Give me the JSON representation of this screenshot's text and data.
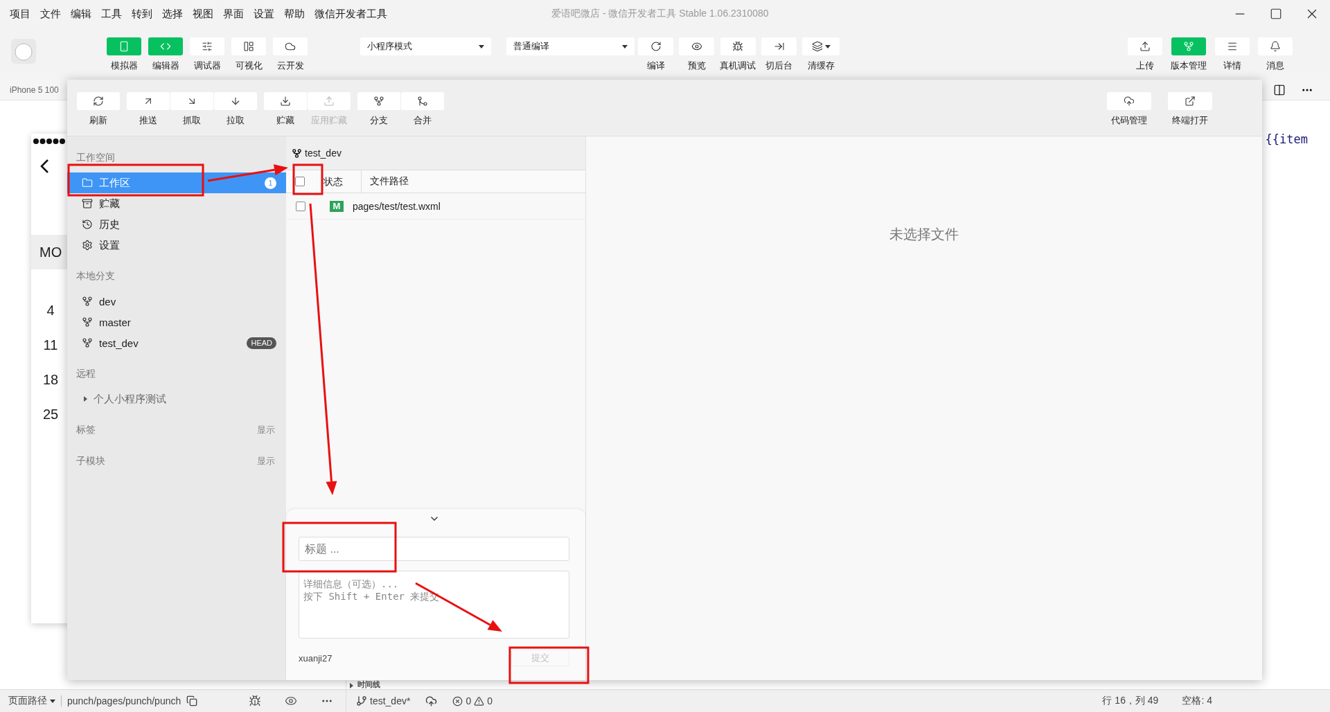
{
  "menu": [
    "项目",
    "文件",
    "编辑",
    "工具",
    "转到",
    "选择",
    "视图",
    "界面",
    "设置",
    "帮助",
    "微信开发者工具"
  ],
  "window": {
    "title": "爱语吧微店 - 微信开发者工具 Stable 1.06.2310080"
  },
  "toolbar": {
    "left": [
      {
        "label": "模拟器",
        "kind": "simulator",
        "selected": true
      },
      {
        "label": "编辑器",
        "kind": "editor",
        "selected": true
      },
      {
        "label": "调试器",
        "kind": "debugger",
        "selected": false
      },
      {
        "label": "可视化",
        "kind": "visual",
        "selected": false
      },
      {
        "label": "云开发",
        "kind": "cloud",
        "selected": false
      }
    ],
    "mode_select": "小程序模式",
    "compile_select": "普通编译",
    "center": [
      {
        "label": "编译",
        "kind": "compile"
      },
      {
        "label": "预览",
        "kind": "preview"
      },
      {
        "label": "真机调试",
        "kind": "remote-debug"
      },
      {
        "label": "切后台",
        "kind": "background"
      },
      {
        "label": "清缓存",
        "kind": "cache"
      }
    ],
    "right": [
      {
        "label": "上传",
        "kind": "upload",
        "selected": false
      },
      {
        "label": "版本管理",
        "kind": "version",
        "selected": true
      },
      {
        "label": "详情",
        "kind": "details",
        "selected": false
      },
      {
        "label": "消息",
        "kind": "messages",
        "selected": false
      }
    ]
  },
  "simulator": {
    "device": "iPhone 5 100",
    "calendar_header": "MO",
    "days": [
      "4",
      "11",
      "18",
      "25"
    ]
  },
  "git": {
    "toolbar_groups": [
      [
        {
          "label": "刷新",
          "kind": "refresh",
          "disabled": false
        }
      ],
      [
        {
          "label": "推送",
          "kind": "push",
          "disabled": false
        },
        {
          "label": "抓取",
          "kind": "fetch",
          "disabled": false
        },
        {
          "label": "拉取",
          "kind": "pull",
          "disabled": false
        }
      ],
      [
        {
          "label": "贮藏",
          "kind": "stash",
          "disabled": false
        },
        {
          "label": "应用贮藏",
          "kind": "apply",
          "disabled": true
        }
      ],
      [
        {
          "label": "分支",
          "kind": "branch",
          "disabled": false
        },
        {
          "label": "合并",
          "kind": "merge",
          "disabled": false
        }
      ]
    ],
    "toolbar_right": [
      {
        "label": "代码管理",
        "kind": "code",
        "disabled": false
      },
      {
        "label": "终端打开",
        "kind": "terminal",
        "disabled": false
      }
    ],
    "sidebar": [
      {
        "title": "工作空间",
        "items": [
          {
            "label": "工作区",
            "kind": "folder",
            "selected": true,
            "badge": {
              "text": "1",
              "kind": "count"
            }
          },
          {
            "label": "贮藏",
            "kind": "stash",
            "selected": false
          },
          {
            "label": "历史",
            "kind": "history",
            "selected": false
          },
          {
            "label": "设置",
            "kind": "settings",
            "selected": false
          }
        ]
      },
      {
        "title": "本地分支",
        "items": [
          {
            "label": "dev",
            "kind": "branch",
            "selected": false
          },
          {
            "label": "master",
            "kind": "branch",
            "selected": false
          },
          {
            "label": "test_dev",
            "kind": "branch",
            "selected": false,
            "badge": {
              "text": "HEAD",
              "kind": "tag"
            }
          }
        ]
      },
      {
        "title": "远程",
        "items": [
          {
            "label": "个人小程序测试",
            "kind": "remote",
            "selected": false,
            "expanded": false
          }
        ]
      },
      {
        "title": "标签",
        "action": "显示"
      },
      {
        "title": "子模块",
        "action": "显示"
      }
    ],
    "branch": "test_dev",
    "all_checked": false,
    "columns": [
      "状态",
      "文件路径"
    ],
    "files": [
      {
        "status": "M",
        "path": "pages/test/test.wxml",
        "checked": false
      }
    ],
    "commit": {
      "title": {
        "placeholder": "标题 ..."
      },
      "detail": {
        "placeholder": "详细信息（可选）...\n按下 Shift + Enter 来提交"
      },
      "author": "xuanji27",
      "submit": {
        "label": "提交",
        "disabled": true
      }
    },
    "preview": {
      "empty_text": "未选择文件"
    }
  },
  "editor": {
    "code": "{{item",
    "timeline": "时间线"
  },
  "status_bar": {
    "path_label": "页面路径",
    "path": "punch/pages/punch/punch",
    "branch": "test_dev*",
    "errors": "0",
    "warnings": "0",
    "position": "行 16，列 49",
    "indent": "空格: 4"
  }
}
